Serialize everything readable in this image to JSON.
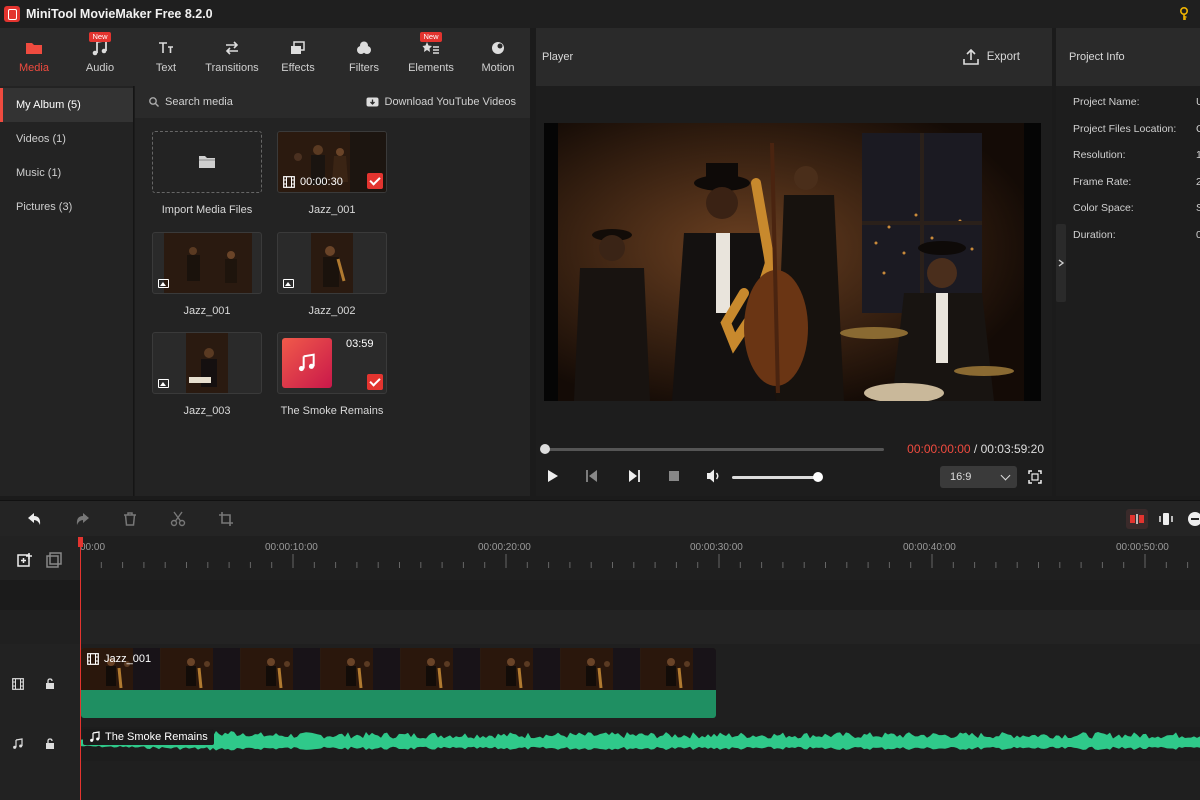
{
  "app": {
    "title": "MiniTool MovieMaker Free 8.2.0"
  },
  "toolbar": {
    "tabs": [
      {
        "label": "Media",
        "icon": "folder-icon",
        "active": true,
        "badge": ""
      },
      {
        "label": "Audio",
        "icon": "music-note-icon",
        "active": false,
        "badge": "New"
      },
      {
        "label": "Text",
        "icon": "text-icon",
        "active": false,
        "badge": ""
      },
      {
        "label": "Transitions",
        "icon": "transitions-icon",
        "active": false,
        "badge": ""
      },
      {
        "label": "Effects",
        "icon": "effects-icon",
        "active": false,
        "badge": ""
      },
      {
        "label": "Filters",
        "icon": "filters-icon",
        "active": false,
        "badge": ""
      },
      {
        "label": "Elements",
        "icon": "elements-icon",
        "active": false,
        "badge": "New"
      },
      {
        "label": "Motion",
        "icon": "motion-icon",
        "active": false,
        "badge": ""
      }
    ]
  },
  "sidebar": {
    "items": [
      {
        "label": "My Album (5)",
        "active": true
      },
      {
        "label": "Videos (1)",
        "active": false
      },
      {
        "label": "Music (1)",
        "active": false
      },
      {
        "label": "Pictures (3)",
        "active": false
      }
    ]
  },
  "media": {
    "search_label": "Search media",
    "download_label": "Download YouTube Videos",
    "tiles": [
      {
        "label": "Import Media Files",
        "kind": "import"
      },
      {
        "label": "Jazz_001",
        "kind": "video",
        "duration": "00:00:30",
        "checked": true
      },
      {
        "label": "Jazz_001",
        "kind": "image"
      },
      {
        "label": "Jazz_002",
        "kind": "image"
      },
      {
        "label": "Jazz_003",
        "kind": "image"
      },
      {
        "label": "The Smoke Remains",
        "kind": "music",
        "duration": "03:59",
        "checked": true
      }
    ]
  },
  "player": {
    "title": "Player",
    "export_label": "Export",
    "current_time": "00:00:00:00",
    "separator": " / ",
    "total_time": "00:03:59:20",
    "aspect_ratio": "16:9",
    "progress": 0,
    "volume": 1
  },
  "project_info": {
    "title": "Project Info",
    "rows": [
      {
        "label": "Project Name:",
        "value": "U"
      },
      {
        "label": "Project Files Location:",
        "value": "C"
      },
      {
        "label": "Resolution:",
        "value": "1"
      },
      {
        "label": "Frame Rate:",
        "value": "2"
      },
      {
        "label": "Color Space:",
        "value": "S"
      },
      {
        "label": "Duration:",
        "value": "0"
      }
    ]
  },
  "timeline": {
    "ruler_labels": [
      "00:00",
      "00:00:10:00",
      "00:00:20:00",
      "00:00:30:00",
      "00:00:40:00",
      "00:00:50:00"
    ],
    "video_clip": {
      "label": "Jazz_001"
    },
    "audio_clip": {
      "label": "The Smoke Remains"
    }
  },
  "colors": {
    "accent": "#ef4b3f",
    "video_clip": "#1f8f62",
    "audio_wave": "#2fc98a",
    "background": "#1b1b1b"
  }
}
